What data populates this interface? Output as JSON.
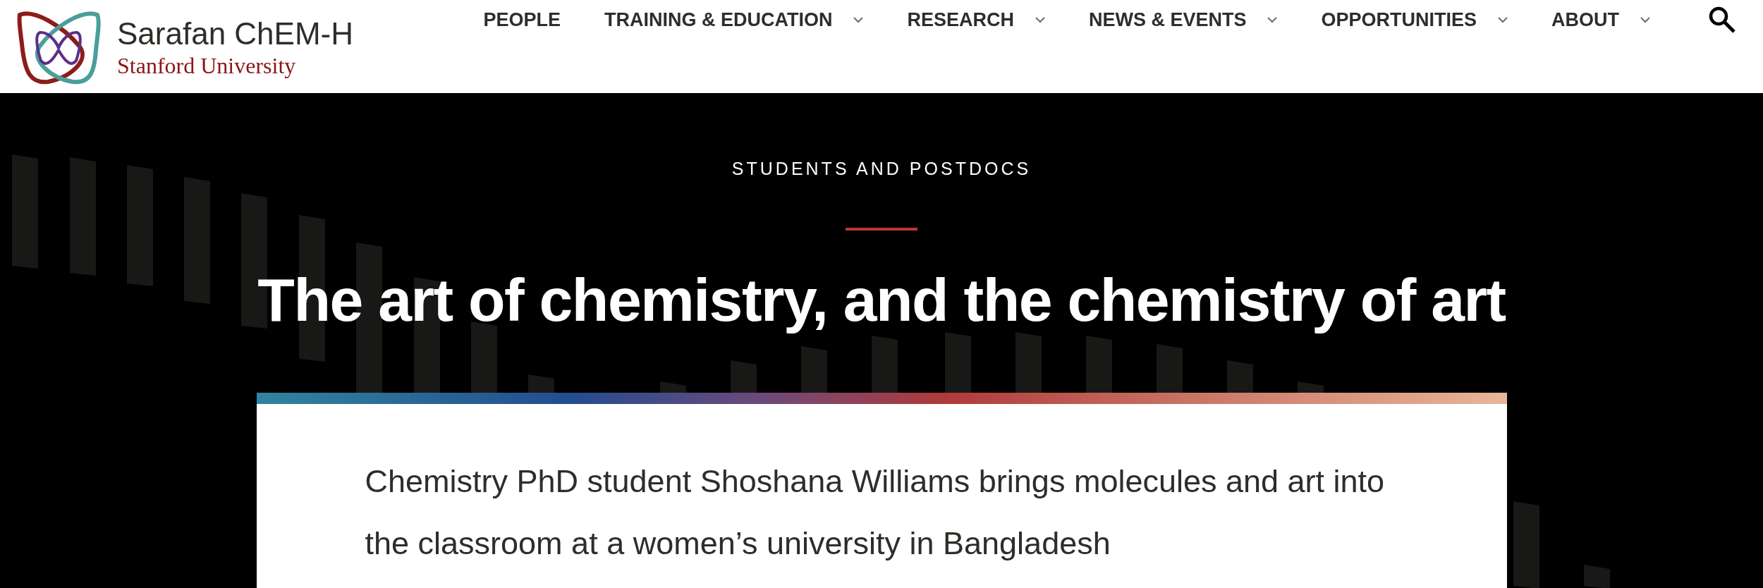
{
  "header": {
    "logo": {
      "title": "Sarafan ChEM-H",
      "subtitle": "Stanford University"
    },
    "nav": [
      {
        "label": "PEOPLE",
        "kind": "link"
      },
      {
        "label": "TRAINING & EDUCATION",
        "kind": "dropdown"
      },
      {
        "label": "RESEARCH",
        "kind": "dropdown"
      },
      {
        "label": "NEWS & EVENTS",
        "kind": "dropdown"
      },
      {
        "label": "OPPORTUNITIES",
        "kind": "dropdown"
      },
      {
        "label": "ABOUT",
        "kind": "dropdown"
      }
    ]
  },
  "hero": {
    "eyebrow": "STUDENTS AND POSTDOCS",
    "title": "The art of chemistry, and the chemistry of art",
    "summary": "Chemistry PhD student Shoshana Williams brings molecules and art into the classroom at a women’s university in Bangladesh"
  }
}
